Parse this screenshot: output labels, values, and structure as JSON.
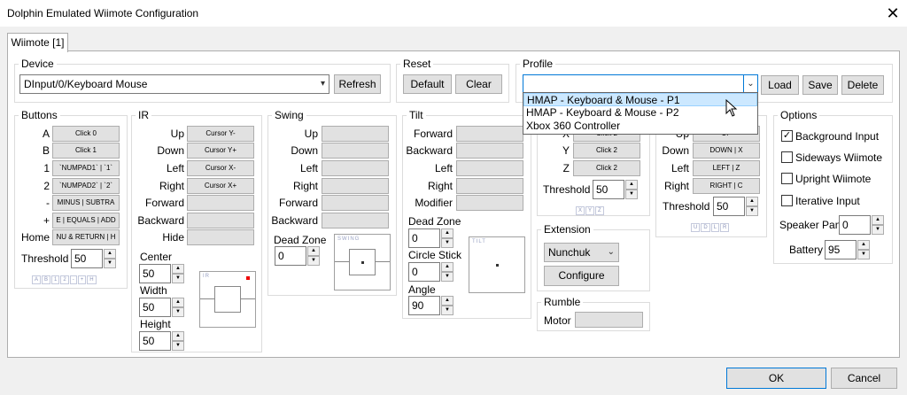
{
  "window": {
    "title": "Dolphin Emulated Wiimote Configuration",
    "close": "✕"
  },
  "tab": {
    "label": "Wiimote [1]"
  },
  "device": {
    "group": "Device",
    "value": "DInput/0/Keyboard Mouse",
    "refresh": "Refresh"
  },
  "reset": {
    "group": "Reset",
    "default": "Default",
    "clear": "Clear"
  },
  "profile": {
    "group": "Profile",
    "value": "",
    "load": "Load",
    "save": "Save",
    "delete": "Delete",
    "options": [
      "HMAP - Keyboard & Mouse - P1",
      "HMAP - Keyboard & Mouse - P2",
      "Xbox 360 Controller"
    ]
  },
  "buttons": {
    "group": "Buttons",
    "rows": [
      {
        "label": "A",
        "bind": "Click 0"
      },
      {
        "label": "B",
        "bind": "Click 1"
      },
      {
        "label": "1",
        "bind": "`NUMPAD1` | `1`"
      },
      {
        "label": "2",
        "bind": "`NUMPAD2` | `2`"
      },
      {
        "label": "-",
        "bind": "MINUS | SUBTRA"
      },
      {
        "label": "+",
        "bind": "E | EQUALS | ADD"
      },
      {
        "label": "Home",
        "bind": "NU & RETURN | H"
      }
    ],
    "threshold_label": "Threshold",
    "threshold": "50",
    "indicators": [
      "A",
      "B",
      "1",
      "2",
      "-",
      "+",
      "H"
    ]
  },
  "ir": {
    "group": "IR",
    "rows": [
      {
        "label": "Up",
        "bind": "Cursor Y-"
      },
      {
        "label": "Down",
        "bind": "Cursor Y+"
      },
      {
        "label": "Left",
        "bind": "Cursor X-"
      },
      {
        "label": "Right",
        "bind": "Cursor X+"
      },
      {
        "label": "Forward",
        "bind": ""
      },
      {
        "label": "Backward",
        "bind": ""
      },
      {
        "label": "Hide",
        "bind": ""
      }
    ],
    "center_label": "Center",
    "center": "50",
    "width_label": "Width",
    "width": "50",
    "height_label": "Height",
    "height": "50",
    "preview_label": "IR"
  },
  "swing": {
    "group": "Swing",
    "rows": [
      {
        "label": "Up",
        "bind": ""
      },
      {
        "label": "Down",
        "bind": ""
      },
      {
        "label": "Left",
        "bind": ""
      },
      {
        "label": "Right",
        "bind": ""
      },
      {
        "label": "Forward",
        "bind": ""
      },
      {
        "label": "Backward",
        "bind": ""
      }
    ],
    "deadzone_label": "Dead Zone",
    "deadzone": "0",
    "preview_label": "SWING"
  },
  "tilt": {
    "group": "Tilt",
    "rows": [
      {
        "label": "Forward",
        "bind": ""
      },
      {
        "label": "Backward",
        "bind": ""
      },
      {
        "label": "Left",
        "bind": ""
      },
      {
        "label": "Right",
        "bind": ""
      },
      {
        "label": "Modifier",
        "bind": ""
      }
    ],
    "deadzone_label": "Dead Zone",
    "deadzone": "0",
    "circle_label": "Circle Stick",
    "circle": "0",
    "angle_label": "Angle",
    "angle": "90",
    "preview_label": "TILT"
  },
  "shake": {
    "rows": [
      {
        "label": "X",
        "bind": "Click 2"
      },
      {
        "label": "Y",
        "bind": "Click 2"
      },
      {
        "label": "Z",
        "bind": "Click 2"
      }
    ],
    "threshold_label": "Threshold",
    "threshold": "50",
    "indicators": [
      "X",
      "Y",
      "Z"
    ]
  },
  "dpad": {
    "rows": [
      {
        "label": "Up",
        "bind": "UP"
      },
      {
        "label": "Down",
        "bind": "DOWN | X"
      },
      {
        "label": "Left",
        "bind": "LEFT | Z"
      },
      {
        "label": "Right",
        "bind": "RIGHT | C"
      }
    ],
    "threshold_label": "Threshold",
    "threshold": "50",
    "indicators": [
      "U",
      "D",
      "L",
      "R"
    ]
  },
  "extension": {
    "group": "Extension",
    "value": "Nunchuk",
    "configure": "Configure"
  },
  "rumble": {
    "group": "Rumble",
    "motor_label": "Motor",
    "motor": ""
  },
  "options": {
    "group": "Options",
    "background_input": "Background Input",
    "sideways": "Sideways Wiimote",
    "upright": "Upright Wiimote",
    "iterative": "Iterative Input",
    "speaker_label": "Speaker Pan",
    "speaker": "0",
    "battery_label": "Battery",
    "battery": "95",
    "checked_mark": "✓"
  },
  "footer": {
    "ok": "OK",
    "cancel": "Cancel"
  }
}
